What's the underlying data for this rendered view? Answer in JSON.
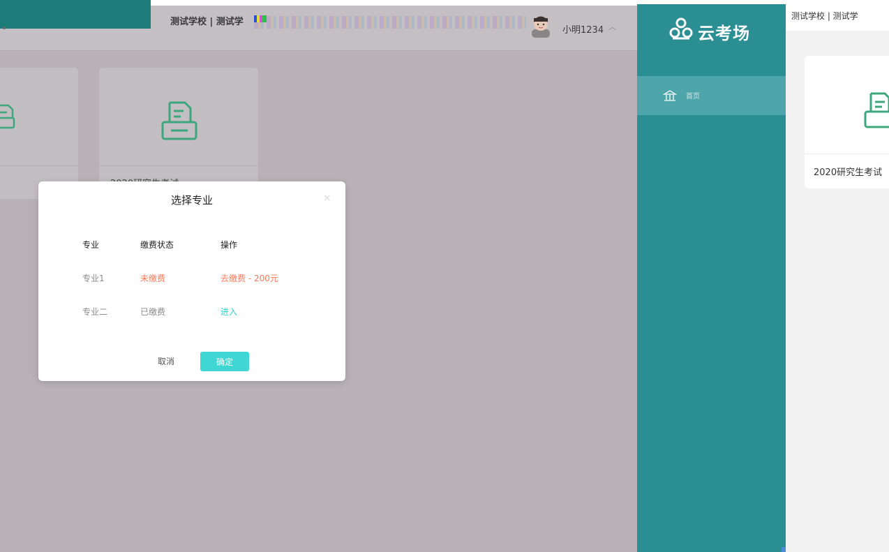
{
  "left_app": {
    "school_text": "测试学校 | 测试学",
    "username": "小明1234",
    "user_caret": "︿",
    "card_title": "2020研究生考试"
  },
  "modal": {
    "title": "选择专业",
    "close": "×",
    "headers": [
      "专业",
      "缴费状态",
      "操作"
    ],
    "rows": [
      {
        "major": "专业1",
        "status": "未缴费",
        "action": "去缴费 - 200元",
        "status_color": "#ff7a5c",
        "action_color": "#ff7a5c"
      },
      {
        "major": "专业二",
        "status": "已缴费",
        "action": "进入",
        "status_color": "#8c8c8c",
        "action_color": "#35d4cf"
      }
    ],
    "cancel_label": "取消",
    "ok_label": "确定"
  },
  "right_app": {
    "logo_text": "云考场",
    "logo_icon": "cloud-exam-logo-icon",
    "sidebar": {
      "items": [
        {
          "label": "首页",
          "icon": "bank-home-icon",
          "active": true
        }
      ]
    },
    "school_text": "测试学校 | 测试学",
    "card_title": "2020研究生考试",
    "card_icon": "document-printer-icon"
  },
  "colors": {
    "sidebar_bg": "#2b8e93",
    "sidebar_active": "#4ea6aa",
    "primary_button": "#40d6d4",
    "warning_text": "#ff7a5c",
    "link_teal": "#35d4cf",
    "overlay": "#b8b2b7"
  }
}
